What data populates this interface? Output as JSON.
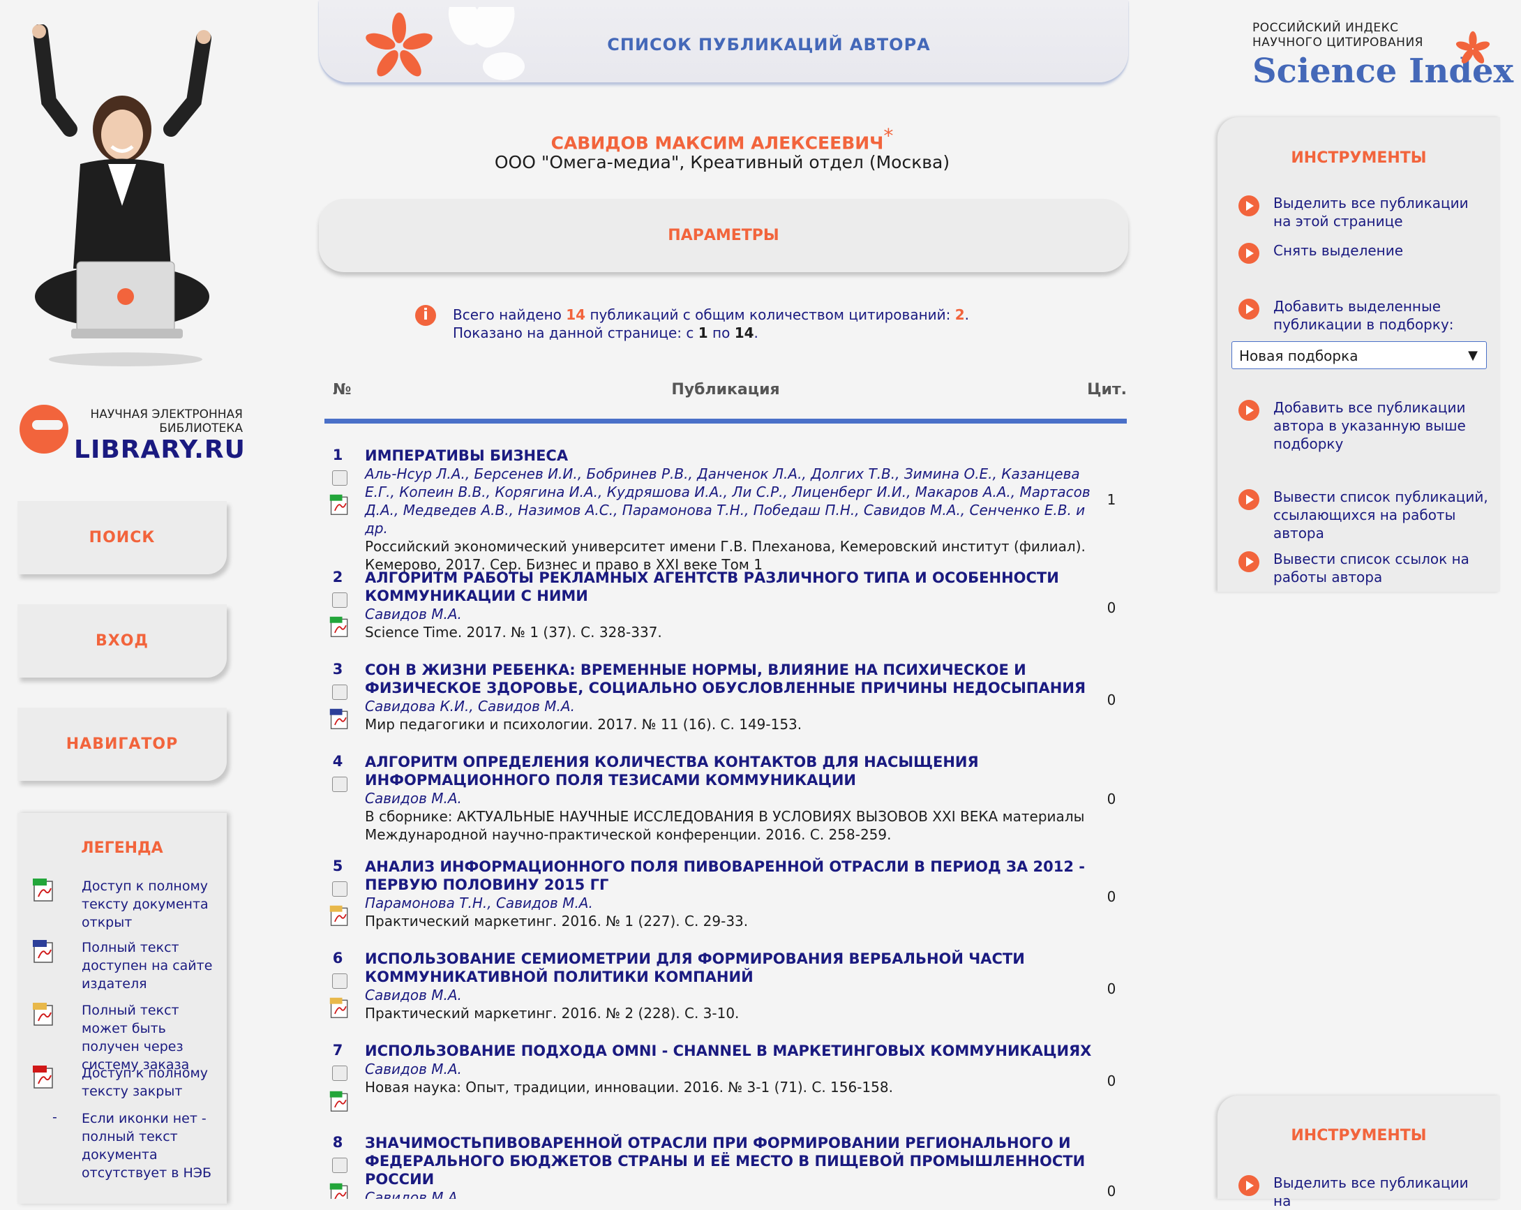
{
  "header": {
    "title": "СПИСОК ПУБЛИКАЦИЙ АВТОРА"
  },
  "left": {
    "logo_caption_1": "НАУЧНАЯ ЭЛЕКТРОННАЯ",
    "logo_caption_2": "БИБЛИОТЕКА",
    "logo_name": "LIBRARY.RU",
    "buttons": [
      "ПОИСК",
      "ВХОД",
      "НАВИГАТОР"
    ],
    "legend_title": "ЛЕГЕНДА",
    "legend": [
      {
        "icon": "pdf-green-icon",
        "text": "Доступ к полному тексту документа открыт"
      },
      {
        "icon": "pdf-blue-icon",
        "text": "Полный текст доступен на сайте издателя"
      },
      {
        "icon": "pdf-yellow-icon",
        "text": "Полный текст может быть получен через систему заказа"
      },
      {
        "icon": "pdf-red-icon",
        "text": "Доступ к полному тексту закрыт"
      },
      {
        "dash": "-",
        "text": "Если иконки нет - полный текст документа отсутствует в НЭБ"
      }
    ]
  },
  "author": {
    "name": "САВИДОВ МАКСИМ АЛЕКСЕЕВИЧ",
    "star": "*",
    "org": "ООО \"Омега-медиа\", Креативный отдел (Москва)"
  },
  "params_label": "ПАРАМЕТРЫ",
  "summary": {
    "line1_a": "Всего найдено ",
    "total": "14",
    "line1_b": " публикаций с общим количеством цитирований: ",
    "citations": "2",
    "line1_c": ".",
    "line2_a": "Показано на данной странице: с ",
    "from": "1",
    "line2_b": " по ",
    "to": "14",
    "line2_c": "."
  },
  "table": {
    "col_num": "№",
    "col_pub": "Публикация",
    "col_cit": "Цит."
  },
  "publications": [
    {
      "num": "1",
      "title": "ИМПЕРАТИВЫ БИЗНЕСА",
      "authors": "Аль-Нсур Л.А., Берсенев И.И., Бобринев Р.В., Данченок Л.А., Долгих Т.В., Зимина О.Е., Казанцева Е.Г., Копеин В.В., Корягина И.А., Кудряшова И.А., Ли С.Р., Лиценберг И.И., Макаров А.А., Мартасов Д.А., Медведев А.В., Назимов А.С., Парамонова Т.Н., Победаш П.Н., Савидов М.А., Сенченко Е.В. и др.",
      "source": "Российский экономический университет имени Г.В. Плеханова, Кемеровский институт (филиал). Кемерово, 2017. Сер. Бизнес и право в XXI веке Том 1",
      "cit": "1",
      "icon": "pdf-green-icon"
    },
    {
      "num": "2",
      "title": "АЛГОРИТМ РАБОТЫ РЕКЛАМНЫХ АГЕНТСТВ РАЗЛИЧНОГО ТИПА И ОСОБЕННОСТИ КОММУНИКАЦИИ С НИМИ",
      "authors": "Савидов М.А.",
      "source": "Science Time. 2017. № 1 (37). С. 328-337.",
      "cit": "0",
      "icon": "pdf-green-icon"
    },
    {
      "num": "3",
      "title": "СОН В ЖИЗНИ РЕБЕНКА: ВРЕМЕННЫЕ НОРМЫ, ВЛИЯНИЕ НА ПСИХИЧЕСКОЕ И ФИЗИЧЕСКОЕ ЗДОРОВЬЕ, СОЦИАЛЬНО ОБУСЛОВЛЕННЫЕ ПРИЧИНЫ НЕДОСЫПАНИЯ",
      "authors": "Савидова К.И., Савидов М.А.",
      "source": "Мир педагогики и психологии. 2017. № 11 (16). С. 149-153.",
      "cit": "0",
      "icon": "pdf-blue-icon"
    },
    {
      "num": "4",
      "title": "АЛГОРИТМ ОПРЕДЕЛЕНИЯ КОЛИЧЕСТВА КОНТАКТОВ ДЛЯ НАСЫЩЕНИЯ ИНФОРМАЦИОННОГО ПОЛЯ ТЕЗИСАМИ КОММУНИКАЦИИ",
      "authors": "Савидов М.А.",
      "source": "В сборнике: АКТУАЛЬНЫЕ НАУЧНЫЕ ИССЛЕДОВАНИЯ В УСЛОВИЯХ ВЫЗОВОВ XXI ВЕКА материалы Международной научно-практической конференции. 2016. С. 258-259.",
      "cit": "0",
      "icon": ""
    },
    {
      "num": "5",
      "title": "АНАЛИЗ ИНФОРМАЦИОННОГО ПОЛЯ ПИВОВАРЕННОЙ ОТРАСЛИ В ПЕРИОД ЗА 2012 - ПЕРВУЮ ПОЛОВИНУ 2015 ГГ",
      "authors": "Парамонова Т.Н., Савидов М.А.",
      "source": "Практический маркетинг. 2016. № 1 (227). С. 29-33.",
      "cit": "0",
      "icon": "pdf-yellow-icon"
    },
    {
      "num": "6",
      "title": "ИСПОЛЬЗОВАНИЕ СЕМИОМЕТРИИ ДЛЯ ФОРМИРОВАНИЯ ВЕРБАЛЬНОЙ ЧАСТИ КОММУНИКАТИВНОЙ ПОЛИТИКИ КОМПАНИЙ",
      "authors": "Савидов М.А.",
      "source": "Практический маркетинг. 2016. № 2 (228). С. 3-10.",
      "cit": "0",
      "icon": "pdf-yellow-icon"
    },
    {
      "num": "7",
      "title": "ИСПОЛЬЗОВАНИЕ ПОДХОДА OMNI - CHANNEL В МАРКЕТИНГОВЫХ КОММУНИКАЦИЯХ",
      "authors": "Савидов М.А.",
      "source": "Новая наука: Опыт, традиции, инновации. 2016. № 3-1 (71). С. 156-158.",
      "cit": "0",
      "icon": "pdf-green-icon"
    },
    {
      "num": "8",
      "title": "ЗНАЧИМОСТЬПИВОВАРЕННОЙ ОТРАСЛИ ПРИ ФОРМИРОВАНИИ РЕГИОНАЛЬНОГО И ФЕДЕРАЛЬНОГО БЮДЖЕТОВ СТРАНЫ И ЕЁ МЕСТО В ПИЩЕВОЙ ПРОМЫШЛЕННОСТИ РОССИИ",
      "authors": "Савидов М.А.",
      "source": "",
      "cit": "0",
      "icon": "pdf-green-icon"
    }
  ],
  "right": {
    "logo_caption_1": "РОССИЙСКИЙ ИНДЕКС",
    "logo_caption_2": "НАУЧНОГО ЦИТИРОВАНИЯ",
    "logo_name": "Science Index",
    "tools_title": "ИНСТРУМЕНТЫ",
    "tools": [
      "Выделить все публикации на этой странице",
      "Снять выделение",
      "Добавить выделенные публикации в подборку:",
      "Добавить все публикации автора в указанную выше подборку",
      "Вывести список публикаций, ссылающихся на работы автора",
      "Вывести список ссылок на работы автора"
    ],
    "select_value": "Новая подборка",
    "tools2_title": "ИНСТРУМЕНТЫ",
    "tools2_first": "Выделить все публикации на"
  },
  "colors": {
    "accent": "#f2643c",
    "navy": "#1a1a80",
    "blue": "#4468b8",
    "rule": "#4a70c8"
  }
}
